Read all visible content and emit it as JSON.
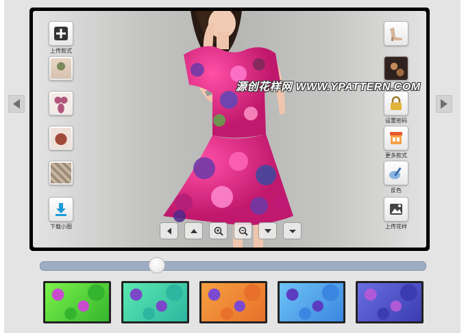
{
  "watermark": "源创花样网 WWW.YPATTERN.COM",
  "left_tools": [
    {
      "name": "upload-style-button",
      "label": "上传款式",
      "icon": "plus-icon"
    },
    {
      "name": "style-thumb-1",
      "label": "",
      "icon": "dress-thumbnail-icon"
    },
    {
      "name": "style-thumb-2",
      "label": "",
      "icon": "bikini-thumbnail-icon"
    },
    {
      "name": "style-thumb-3",
      "label": "",
      "icon": "shirt-thumbnail-icon"
    },
    {
      "name": "style-thumb-4",
      "label": "",
      "icon": "fabric-thumbnail-icon"
    },
    {
      "name": "download-thumb-button",
      "label": "下载小图",
      "icon": "download-icon"
    }
  ],
  "right_tools": [
    {
      "name": "shoe-thumb",
      "label": "",
      "icon": "shoe-thumbnail-icon"
    },
    {
      "name": "pattern-thumb",
      "label": "",
      "icon": "pattern-thumbnail-icon"
    },
    {
      "name": "set-password-button",
      "label": "设置密码",
      "icon": "lock-icon"
    },
    {
      "name": "more-styles-button",
      "label": "更多款式",
      "icon": "store-icon"
    },
    {
      "name": "invert-color-button",
      "label": "反色",
      "icon": "paint-brush-icon"
    },
    {
      "name": "upload-pattern-button",
      "label": "上传花样",
      "icon": "image-upload-icon"
    }
  ],
  "view_controls": [
    "arrow-left-icon",
    "arrow-up-icon",
    "zoom-in-icon",
    "zoom-out-icon",
    "arrow-down-icon",
    "chevron-down-icon"
  ],
  "slider": {
    "value": 0.3
  },
  "swatches": [
    {
      "name": "green",
      "colors": [
        "#7cf24a",
        "#35b52e",
        "#c84bd0"
      ]
    },
    {
      "name": "teal",
      "colors": [
        "#5ae8b0",
        "#2fb6a0",
        "#7a48c8"
      ]
    },
    {
      "name": "orange",
      "colors": [
        "#f5a040",
        "#e8702a",
        "#7b4ad0"
      ]
    },
    {
      "name": "blue",
      "colors": [
        "#6ec4f5",
        "#3a86e0",
        "#5a3cc0"
      ]
    },
    {
      "name": "indigo",
      "colors": [
        "#6a6ee0",
        "#3a3cb0",
        "#b05ad8"
      ]
    }
  ]
}
